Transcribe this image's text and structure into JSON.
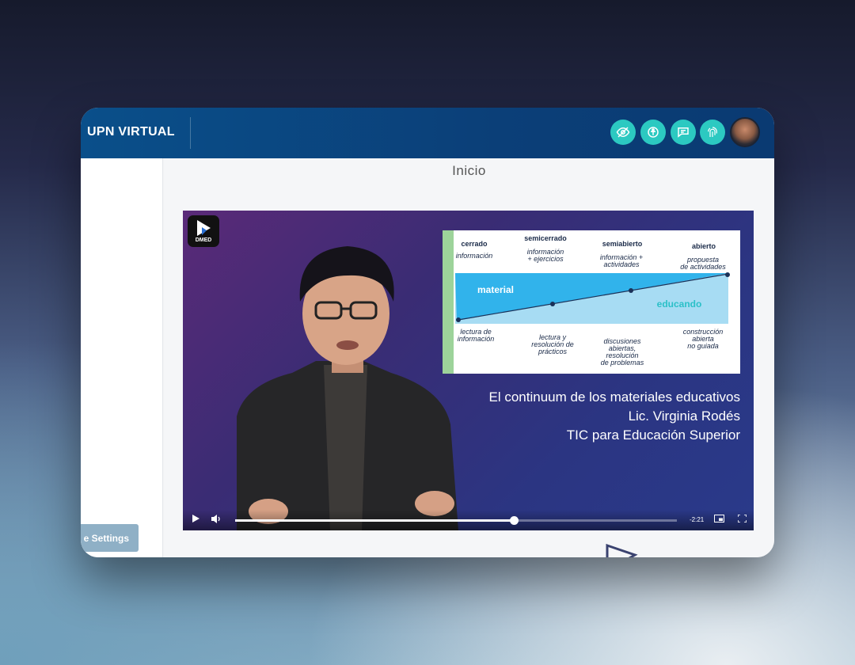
{
  "app": {
    "brand": "UPN VIRTUAL"
  },
  "toolbar": {
    "icons": [
      "eye-slash-icon",
      "accessibility-icon",
      "chat-icon",
      "fingerprint-icon"
    ],
    "accent": "#2cc9c1"
  },
  "main": {
    "page_title": "Inicio"
  },
  "video": {
    "logo_text": "DMED",
    "slide": {
      "headers": [
        "cerrado",
        "semicerrado",
        "semiabierto",
        "abierto"
      ],
      "subheaders": [
        "información",
        "información\n+ ejercicios",
        "información +\nactividades",
        "propuesta\nde actividades"
      ],
      "band_left": "material",
      "band_right": "educando",
      "footers": [
        "lectura de\ninformación",
        "lectura y\nresolución de\nprácticos",
        "discusiones\nabiertas,\nresolución\nde problemas",
        "construcción\nabierta\nno guiada"
      ]
    },
    "caption_lines": [
      "El continuum de los materiales educativos",
      "Lic. Virginia Rodés",
      "TIC para Educación Superior"
    ],
    "time_remaining": "-2:21",
    "progress": 0.63
  },
  "sidebar": {
    "settings_label": "e Settings"
  }
}
